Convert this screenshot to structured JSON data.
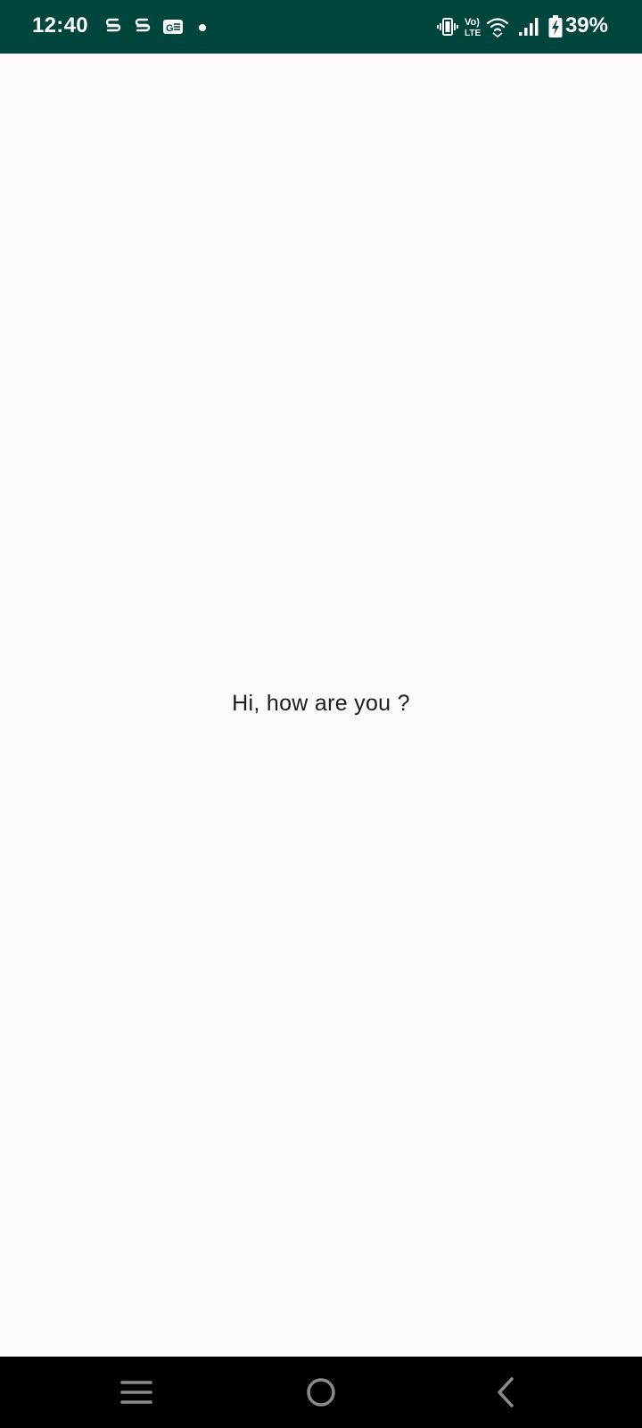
{
  "status_bar": {
    "time": "12:40",
    "battery_percent": "39%",
    "background_color": "#00463d",
    "left_icons": [
      "s-app-icon",
      "s-app-icon",
      "gallery-app-icon",
      "notification-dot-icon"
    ],
    "right_icons": [
      "vibrate-icon",
      "volte-icon",
      "wifi-icon",
      "signal-icon",
      "battery-charging-icon"
    ],
    "volte_label_top": "Vo)",
    "volte_label_bottom": "LTE",
    "gallery_label": "G☰"
  },
  "main": {
    "greeting": "Hi, how are you ?",
    "background_color": "#fdf8fd"
  },
  "nav_bar": {
    "buttons": [
      "recents-button",
      "home-button",
      "back-button"
    ],
    "background_color": "#000000"
  }
}
